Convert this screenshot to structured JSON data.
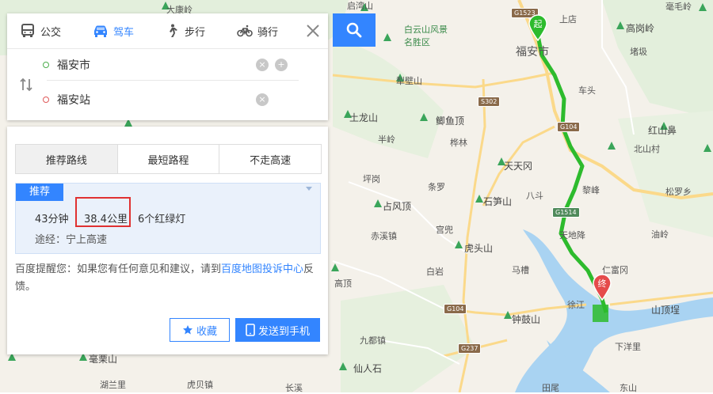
{
  "modes": {
    "bus": "公交",
    "drive": "驾车",
    "walk": "步行",
    "bike": "骑行"
  },
  "route": {
    "from": "福安市",
    "to": "福安站"
  },
  "route_tabs": [
    "推荐路线",
    "最短路程",
    "不走高速"
  ],
  "plan": {
    "badge": "推荐",
    "time": "43分钟",
    "distance": "38.4公里",
    "lights": "6个红绿灯",
    "via": "途经：宁上高速"
  },
  "tip": {
    "prefix": "百度提醒您：如果您有任何意见和建议，请到",
    "link": "百度地图投诉中心",
    "suffix": "反馈。"
  },
  "buttons": {
    "favorite": "收藏",
    "send": "发送到手机"
  },
  "map": {
    "start_marker": "起",
    "end_marker": "终",
    "labels": [
      "启湾山",
      "白云山风景",
      "名胜区",
      "毫毛岭",
      "上店",
      "高岗岭",
      "福安市",
      "堵圾",
      "犁壁山",
      "车头",
      "土龙山",
      "鲫鱼顶",
      "半岭",
      "桦林",
      "红山鼻",
      "北山村",
      "天天冈",
      "黎峰",
      "坪岗",
      "条罗",
      "石笋山",
      "八斗",
      "占风顶",
      "松罗乡",
      "天地降",
      "油岭",
      "赤溪镇",
      "宫兜",
      "虎头山",
      "仁富冈",
      "马槽",
      "白岩",
      "高顶",
      "徐江",
      "山顶埕",
      "钟鼓山",
      "九都镇",
      "下洋里",
      "毫栗山",
      "仙人石",
      "湖兰里",
      "虎贝镇",
      "大康岭",
      "长溪",
      "田尾",
      "东山"
    ],
    "shields": [
      "G1523",
      "S302",
      "G104",
      "G1514",
      "G104",
      "G237"
    ]
  },
  "colors": {
    "accent": "#3385ff",
    "route": "#2dbb2d",
    "highlight": "#e03131"
  }
}
